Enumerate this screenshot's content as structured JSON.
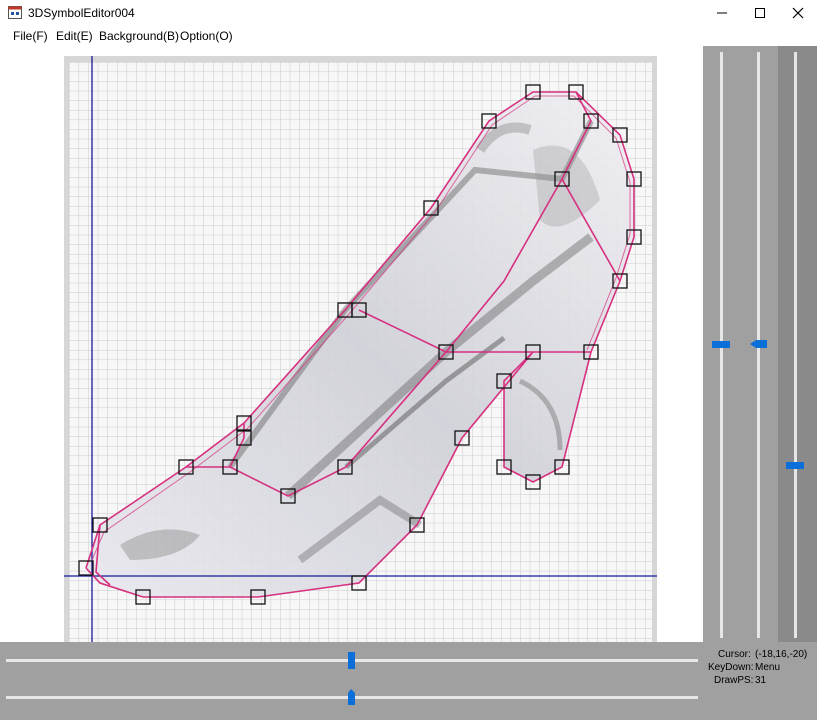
{
  "window": {
    "title": "3DSymbolEditor004"
  },
  "menu": {
    "file": "File(F)",
    "edit": "Edit(E)",
    "background": "Background(B)",
    "option": "Option(O)"
  },
  "status": {
    "cursor_label": "Cursor:",
    "cursor_value": "(-18,16,-20)",
    "keydown_label": "KeyDown:",
    "keydown_value": "Menu",
    "drawps_label": "DrawPS:",
    "drawps_value": "31"
  },
  "colors": {
    "outline": "#d6307f",
    "axis": "#1a1a9a",
    "slider_thumb": "#0a6fd8"
  },
  "icons": {
    "app": "app-window-icon",
    "minimize": "minimize-icon",
    "maximize": "maximize-icon",
    "close": "close-icon"
  }
}
